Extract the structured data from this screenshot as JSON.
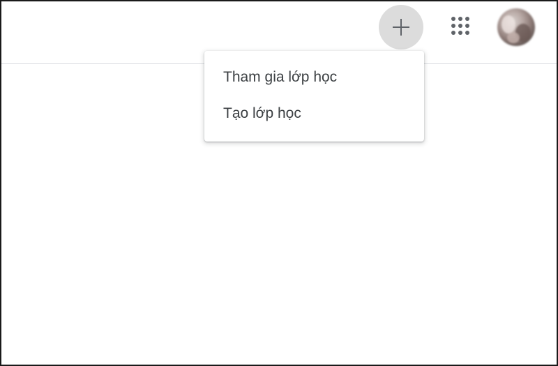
{
  "header": {
    "create_button_icon": "plus-icon",
    "apps_button_icon": "apps-grid-icon",
    "avatar_icon": "user-avatar"
  },
  "menu": {
    "items": [
      {
        "label": "Tham gia lớp học"
      },
      {
        "label": "Tạo lớp học"
      }
    ]
  },
  "colors": {
    "plus_button_bg": "#dcdcdc",
    "icon_color": "#5f6368",
    "menu_text": "#3c4043",
    "divider": "#dadce0"
  }
}
